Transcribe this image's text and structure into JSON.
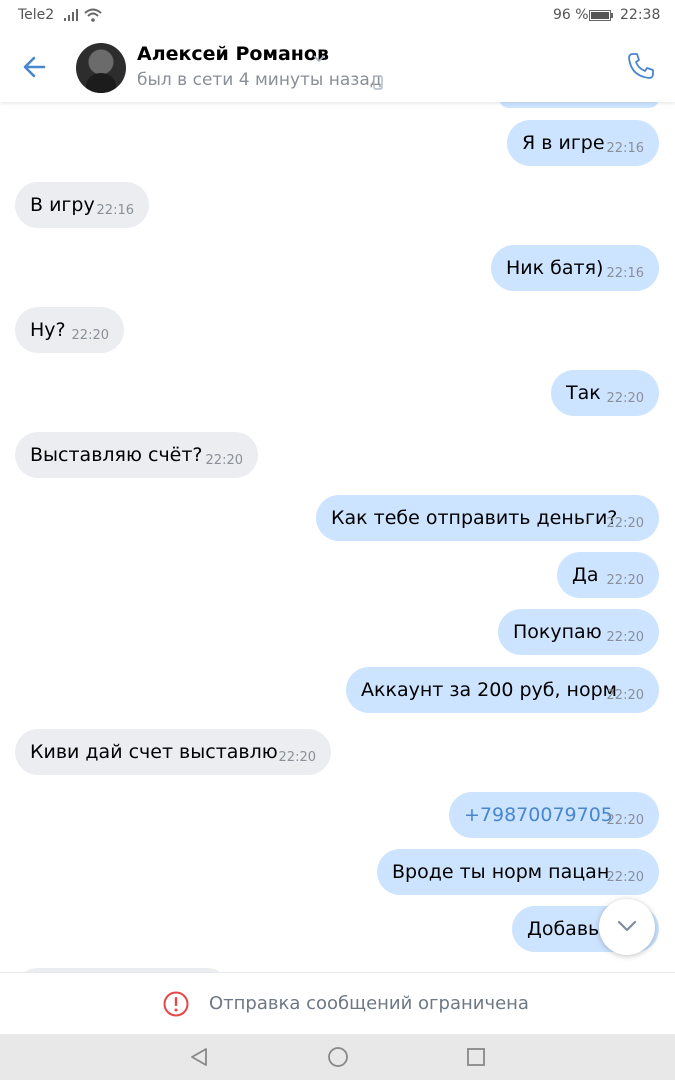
{
  "status_bar": {
    "carrier": "Tele2",
    "battery_percent": "96 %",
    "time": "22:38"
  },
  "header": {
    "name": "Алексей Романов",
    "presence": "был в сети 4 минуты назад"
  },
  "messages": [
    {
      "dir": "out",
      "text": "Я в игре",
      "time": "22:16"
    },
    {
      "dir": "in",
      "text": "В игру",
      "time": "22:16"
    },
    {
      "dir": "out",
      "text": "Ник батя)",
      "time": "22:16"
    },
    {
      "dir": "in",
      "text": "Ну?",
      "time": "22:20"
    },
    {
      "dir": "out",
      "text": "Так",
      "time": "22:20"
    },
    {
      "dir": "in",
      "text": "Выставляю счёт?",
      "time": "22:20"
    },
    {
      "dir": "out",
      "text": "Как тебе отправить деньги?",
      "time": "22:20"
    },
    {
      "dir": "out",
      "text": "Да",
      "time": "22:20"
    },
    {
      "dir": "out",
      "text": "Покупаю",
      "time": "22:20"
    },
    {
      "dir": "out",
      "text": "Аккаунт за 200 руб, норм",
      "time": "22:20"
    },
    {
      "dir": "in",
      "text": "Киви дай счет выставлю",
      "time": "22:20"
    },
    {
      "dir": "out",
      "text": "+79870079705",
      "time": "22:20",
      "link": true
    },
    {
      "dir": "out",
      "text": "Вроде ты норм пацан",
      "time": "22:20"
    },
    {
      "dir": "out",
      "text": "Добавь",
      "time": ""
    }
  ],
  "footer": {
    "restriction_text": "Отправка сообщений ограничена"
  },
  "icons": {
    "back": "arrow-left-icon",
    "call": "phone-icon",
    "scroll_down": "chevron-down-icon",
    "warning": "exclamation-circle-icon"
  },
  "colors": {
    "accent": "#4986cc",
    "incoming_bubble": "#ebedf0",
    "outgoing_bubble": "#cce4ff",
    "warning": "#e64646"
  }
}
